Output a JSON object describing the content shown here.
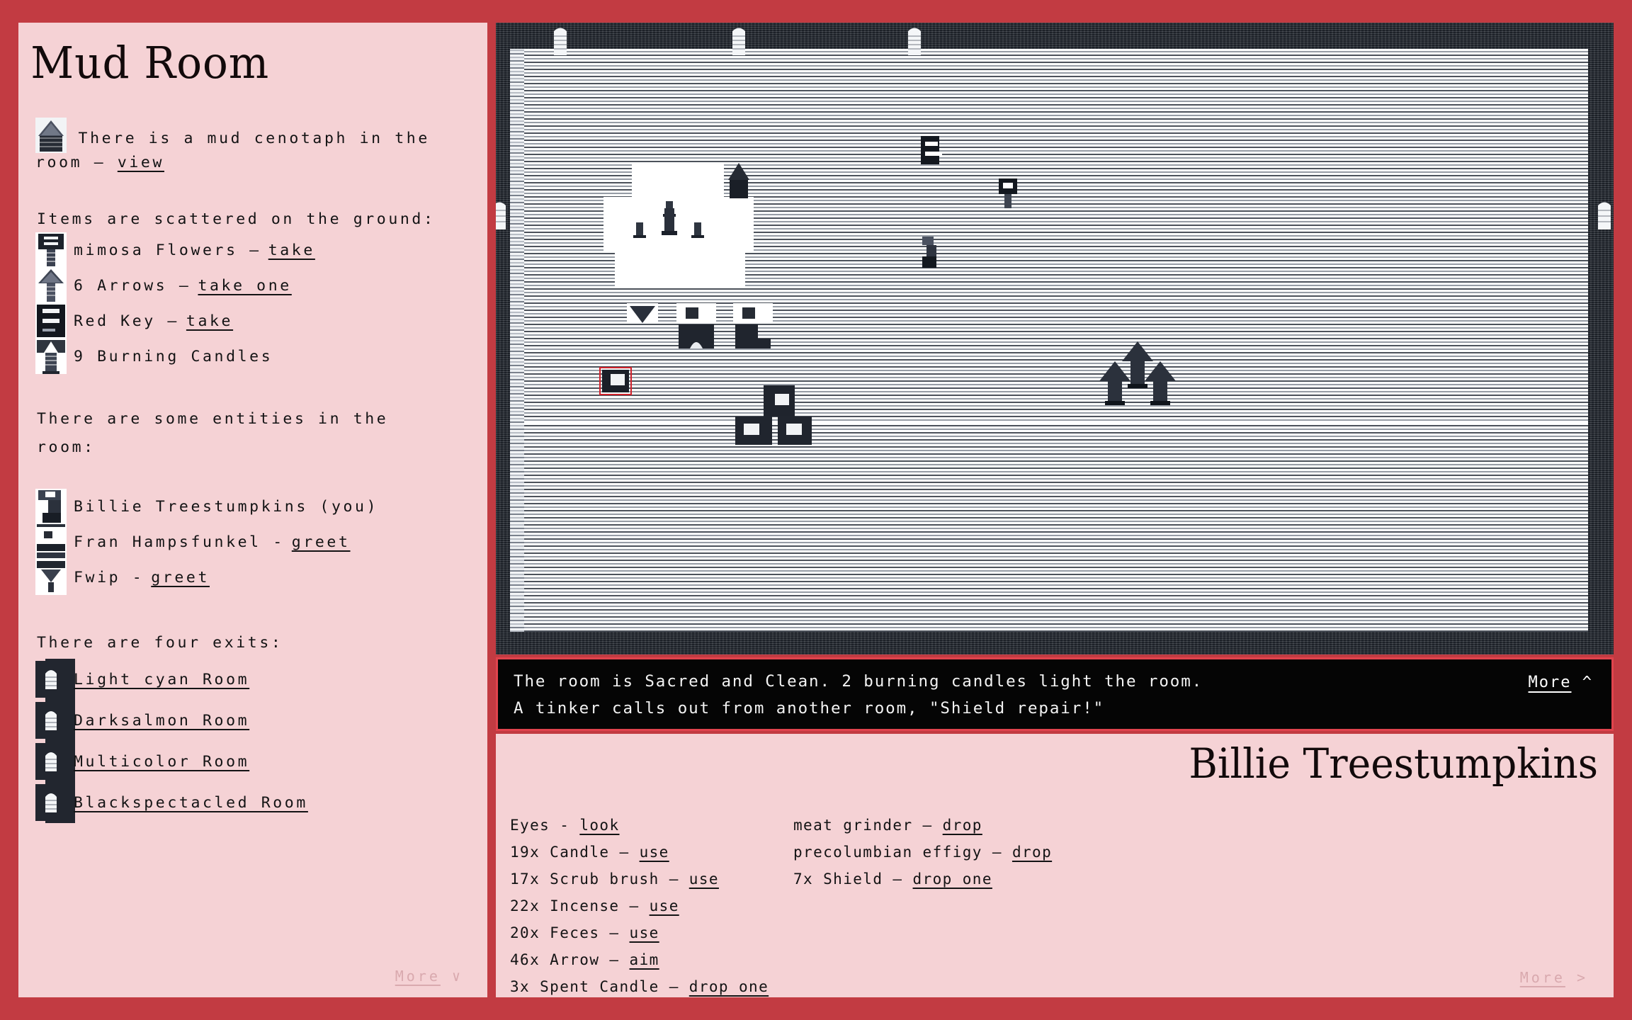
{
  "theme": {
    "frame_color": "#c23b42",
    "panel_bg": "#f5d2d5",
    "status_bg": "#050505",
    "status_border": "#e0434d",
    "text_color": "#131314",
    "muted": "#d9a9ae"
  },
  "room": {
    "title": "Mud Room",
    "cenotaph": {
      "icon": "mud-cenotaph-icon",
      "text_before": "There is a mud cenotaph in the",
      "text_after": "room —",
      "action": "view"
    },
    "items_heading": "Items are scattered on the ground:",
    "items": [
      {
        "icon": "mimosa-flowers-icon",
        "label": "mimosa Flowers —",
        "action": "take"
      },
      {
        "icon": "arrows-icon",
        "label": "6 Arrows —",
        "action": "take one"
      },
      {
        "icon": "red-key-icon",
        "label": "Red Key —",
        "action": "take"
      },
      {
        "icon": "burning-candles-icon",
        "label": "9 Burning Candles",
        "action": ""
      }
    ],
    "entities_heading_line1": "There are some entities in the",
    "entities_heading_line2": "room:",
    "entities": [
      {
        "icon": "billie-treestumpkins-icon",
        "label": "Billie Treestumpkins (you)",
        "action": ""
      },
      {
        "icon": "fran-hampsfunkel-icon",
        "label": "Fran Hampsfunkel -",
        "action": "greet"
      },
      {
        "icon": "fwip-icon",
        "label": "Fwip -",
        "action": "greet"
      }
    ],
    "exits_heading": "There are four exits:",
    "exits": [
      {
        "icon": "door-icon",
        "label": "Light cyan Room"
      },
      {
        "icon": "door-icon",
        "label": "Darksalmon Room"
      },
      {
        "icon": "door-icon",
        "label": "Multicolor Room"
      },
      {
        "icon": "door-icon",
        "label": "Blackspectacled Room"
      }
    ],
    "more_label": "More",
    "more_chevron": "∨"
  },
  "status": {
    "line1": "The room is Sacred and Clean. 2 burning candles light the room.",
    "line2": "A tinker calls out from another room, \"Shield repair!\"",
    "more_label": "More",
    "more_chevron": "^"
  },
  "inventory": {
    "player_name": "Billie Treestumpkins",
    "column1": [
      {
        "label": "Eyes -",
        "action": "look"
      },
      {
        "label": "19x Candle —",
        "action": "use"
      },
      {
        "label": "17x Scrub brush —",
        "action": "use"
      },
      {
        "label": "22x Incense —",
        "action": "use"
      },
      {
        "label": "20x Feces —",
        "action": "use"
      },
      {
        "label": "46x Arrow —",
        "action": "aim"
      },
      {
        "label": "3x Spent Candle —",
        "action": "drop one"
      }
    ],
    "column2": [
      {
        "label": "meat grinder —",
        "action": "drop"
      },
      {
        "label": "precolumbian effigy —",
        "action": "drop"
      },
      {
        "label": "7x Shield —",
        "action": "drop one"
      }
    ],
    "more_label": "More",
    "more_chevron": ">"
  },
  "map": {
    "description": "top-down dithered room view with doors, candles, entities and arrow piles"
  }
}
